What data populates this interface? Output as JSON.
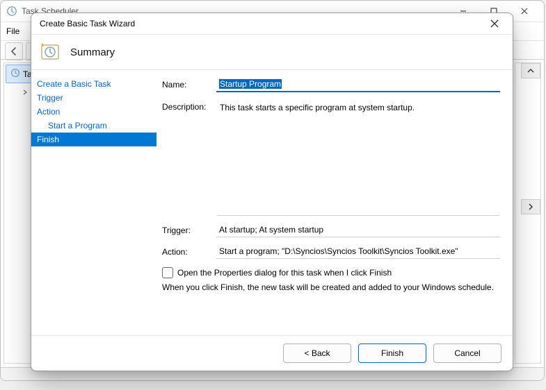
{
  "window": {
    "title": "Task Scheduler",
    "menu": {
      "file": "File"
    },
    "tree": {
      "root": "Task",
      "child_icon": "folder-icon"
    }
  },
  "wizard": {
    "title": "Create Basic Task Wizard",
    "heading": "Summary",
    "steps": {
      "create": "Create a Basic Task",
      "trigger": "Trigger",
      "action": "Action",
      "start_program": "Start a Program",
      "finish": "Finish"
    },
    "labels": {
      "name": "Name:",
      "description": "Description:",
      "trigger": "Trigger:",
      "action": "Action:"
    },
    "values": {
      "name": "Startup Program",
      "description": "This task starts a specific program at system startup.",
      "trigger": "At startup; At system startup",
      "action": "Start a program; \"D:\\Syncios\\Syncios Toolkit\\Syncios Toolkit.exe\""
    },
    "checkbox_label": "Open the Properties dialog for this task when I click Finish",
    "note": "When you click Finish, the new task will be created and added to your Windows schedule.",
    "buttons": {
      "back": "< Back",
      "finish": "Finish",
      "cancel": "Cancel"
    }
  }
}
